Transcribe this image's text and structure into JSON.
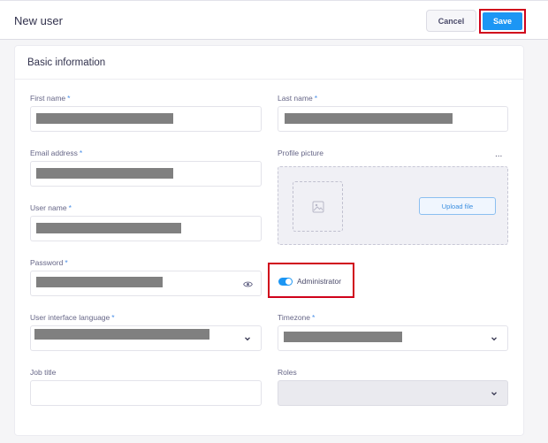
{
  "header": {
    "title": "New user",
    "cancel_label": "Cancel",
    "save_label": "Save"
  },
  "card": {
    "title": "Basic information"
  },
  "fields": {
    "first_name": {
      "label": "First name",
      "required_mark": "*"
    },
    "last_name": {
      "label": "Last name",
      "required_mark": "*"
    },
    "email": {
      "label": "Email address",
      "required_mark": "*"
    },
    "profile_picture": {
      "label": "Profile picture",
      "more_label": "...",
      "upload_label": "Upload file"
    },
    "username": {
      "label": "User name",
      "required_mark": "*"
    },
    "password": {
      "label": "Password",
      "required_mark": "*"
    },
    "administrator": {
      "label": "Administrator",
      "checked": true
    },
    "ui_language": {
      "label": "User interface language",
      "required_mark": "*"
    },
    "timezone": {
      "label": "Timezone",
      "required_mark": "*"
    },
    "job_title": {
      "label": "Job title",
      "value": ""
    },
    "roles": {
      "label": "Roles",
      "value": ""
    }
  },
  "icons": {
    "password_toggle": "eye-icon",
    "select_arrow": "chevron-down-icon",
    "image_placeholder": "image-icon"
  },
  "colors": {
    "primary": "#1c96f4",
    "highlight": "#d0021b",
    "required": "#4a8fe7"
  }
}
